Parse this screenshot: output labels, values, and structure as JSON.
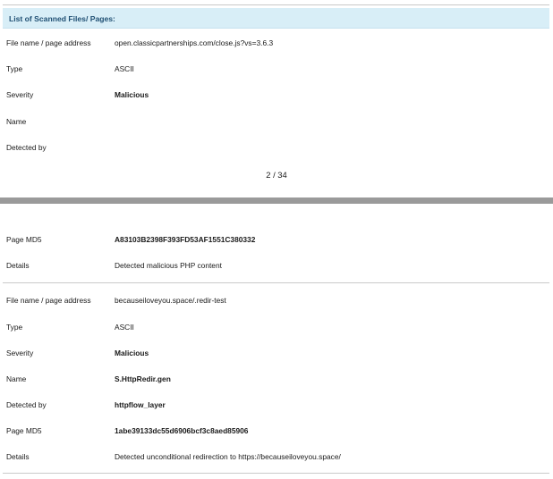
{
  "section_title": "List of Scanned Files/ Pages:",
  "page_indicator": "2 / 34",
  "labels": {
    "file": "File name / page address",
    "type": "Type",
    "severity": "Severity",
    "name": "Name",
    "detected_by": "Detected by",
    "md5": "Page MD5",
    "details": "Details"
  },
  "entry1": {
    "file": "open.classicpartnerships.com/close.js?vs=3.6.3",
    "type": "ASCII",
    "severity": "Malicious",
    "name": "",
    "detected_by": "",
    "md5": "A83103B2398F393FD53AF1551C380332",
    "details": "Detected malicious PHP content"
  },
  "entry2": {
    "file": "becauseiloveyou.space/.redir-test",
    "type": "ASCII",
    "severity": "Malicious",
    "name": "S.HttpRedir.gen",
    "detected_by": "httpflow_layer",
    "md5": "1abe39133dc55d6906bcf3c8aed85906",
    "details": "Detected unconditional redirection to https://becauseiloveyou.space/"
  }
}
